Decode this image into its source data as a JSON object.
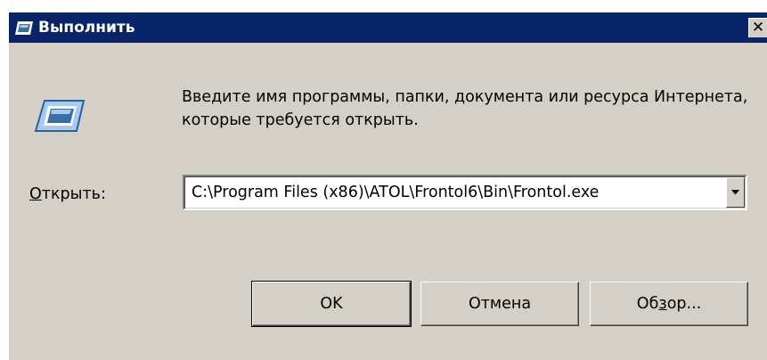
{
  "window": {
    "title": "Выполнить",
    "close_glyph": "✕",
    "icon": "run-window-icon"
  },
  "prompt": {
    "icon": "run-window-icon",
    "text": "Введите имя программы, папки, документа или ресурса Интернета, которые требуется открыть."
  },
  "open_field": {
    "label_prefix": "О",
    "label_rest": "ткрыть:",
    "value": "C:\\Program Files (x86)\\ATOL\\Frontol6\\Bin\\Frontol.exe",
    "dropdown_icon": "chevron-down-icon"
  },
  "buttons": {
    "ok": "OK",
    "cancel": "Отмена",
    "browse_pre": "Об",
    "browse_mnemonic": "з",
    "browse_post": "ор..."
  },
  "colors": {
    "titlebar": "#0a246a",
    "face": "#d4d0c8"
  }
}
